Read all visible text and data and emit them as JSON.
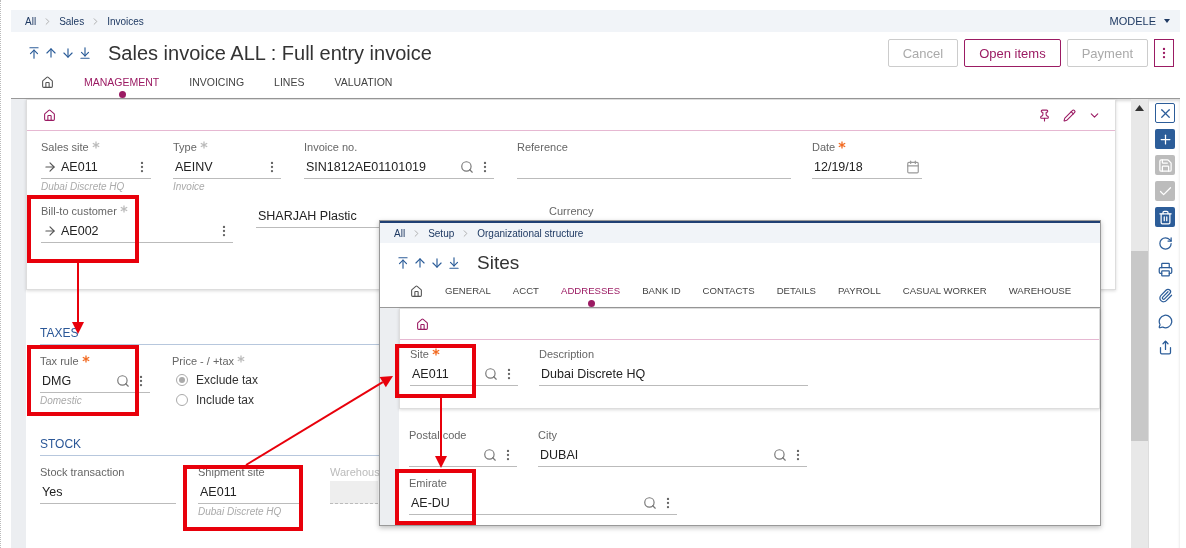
{
  "breadcrumb": [
    "All",
    "Sales",
    "Invoices"
  ],
  "user_menu": "MODELE",
  "title": "Sales invoice ALL : Full entry invoice",
  "actions": [
    {
      "label": "Cancel",
      "disabled": true
    },
    {
      "label": "Open items",
      "disabled": false
    },
    {
      "label": "Payment",
      "disabled": true
    }
  ],
  "tabs": [
    {
      "label": "MANAGEMENT",
      "selected": true
    },
    {
      "label": "INVOICING",
      "selected": false
    },
    {
      "label": "LINES",
      "selected": false
    },
    {
      "label": "VALUATION",
      "selected": false
    }
  ],
  "header_rows": [
    {
      "fields": [
        {
          "label": "Sales site",
          "required": true,
          "color": "#bbbbbb",
          "kind": "choice",
          "link": true,
          "value": "AE011",
          "hint": "Dubai Discrete HQ"
        },
        {
          "label": "Type",
          "required": true,
          "color": "#bbbbbb",
          "kind": "choice",
          "value": "AEINV",
          "hint": "Invoice"
        },
        {
          "label": "Invoice no.",
          "kind": "lookup",
          "value": "SIN1812AE01101019"
        },
        {
          "label": "Reference",
          "kind": "plain"
        },
        {
          "label": "Date",
          "required": true,
          "color": "#f26a21",
          "kind": "date",
          "value": "12/19/18"
        }
      ]
    },
    {
      "fields": [
        {
          "label": "Bill-to customer",
          "required": true,
          "color": "#bbbbbb",
          "kind": "choice",
          "link": true,
          "value": "AE002"
        },
        {
          "kind": "plain",
          "value": "SHARJAH Plastic"
        },
        {
          "label": "Currency",
          "kind": "plain"
        }
      ]
    }
  ],
  "sections": [
    {
      "title": "TAXES",
      "fields": [
        {
          "label": "Tax rule",
          "required": true,
          "color": "#f26a21",
          "kind": "lookup",
          "value": "DMG",
          "hint": "Domestic"
        },
        {
          "label": "Price - / +tax",
          "required": true,
          "color": "#bbbbbb",
          "kind": "radio",
          "options": [
            {
              "label": "Exclude tax",
              "selected": true
            },
            {
              "label": "Include tax",
              "selected": false
            }
          ]
        }
      ]
    },
    {
      "title": "STOCK",
      "fields": [
        {
          "label": "Stock transaction",
          "kind": "plain",
          "value": "Yes"
        },
        {
          "label": "Shipment site",
          "kind": "plain",
          "value": "AE011",
          "hint": "Dubai Discrete HQ"
        },
        {
          "label": "Warehous",
          "kind": "plain",
          "disabled": true
        }
      ]
    }
  ],
  "toolbar": [
    {
      "kind": "close",
      "disabled": false
    },
    {
      "kind": "create",
      "disabled": false
    },
    {
      "kind": "save",
      "disabled": true
    },
    {
      "kind": "validate",
      "disabled": true
    },
    {
      "kind": "delete",
      "disabled": false
    },
    {
      "kind": "refresh",
      "disabled": false
    },
    {
      "kind": "print",
      "disabled": false
    },
    {
      "kind": "attach",
      "disabled": false
    },
    {
      "kind": "comment",
      "disabled": false
    },
    {
      "kind": "export",
      "disabled": false
    }
  ],
  "sites_window": {
    "breadcrumb": [
      "All",
      "Setup",
      "Organizational structure"
    ],
    "title": "Sites",
    "tabs": [
      {
        "label": "GENERAL",
        "selected": false
      },
      {
        "label": "ACCT",
        "selected": false
      },
      {
        "label": "ADDRESSES",
        "selected": true
      },
      {
        "label": "BANK ID",
        "selected": false
      },
      {
        "label": "CONTACTS",
        "selected": false
      },
      {
        "label": "DETAILS",
        "selected": false
      },
      {
        "label": "PAYROLL",
        "selected": false
      },
      {
        "label": "CASUAL WORKER",
        "selected": false
      },
      {
        "label": "WAREHOUSE",
        "selected": false
      }
    ],
    "rows": [
      {
        "fields": [
          {
            "label": "Site",
            "required": true,
            "color": "#f26a21",
            "kind": "lookup",
            "value": "AE011"
          },
          {
            "label": "Description",
            "kind": "plain",
            "value": "Dubai Discrete HQ"
          }
        ]
      },
      {
        "fields": [
          {
            "label": "Postal code",
            "kind": "lookup"
          },
          {
            "label": "City",
            "kind": "lookup",
            "value": "DUBAI"
          }
        ]
      },
      {
        "fields": [
          {
            "label": "Emirate",
            "kind": "lookup",
            "value": "AE-DU"
          }
        ]
      }
    ]
  }
}
